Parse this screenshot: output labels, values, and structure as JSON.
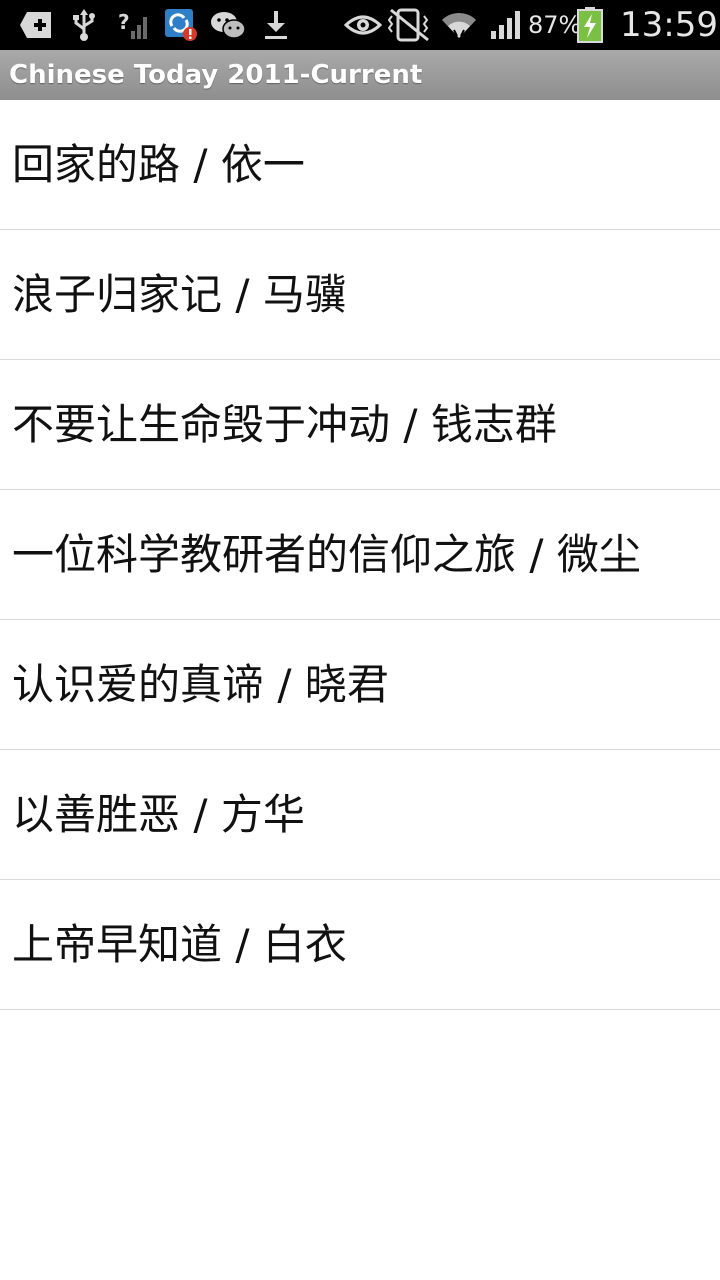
{
  "status_bar": {
    "battery_percent": "87%",
    "time": "13:59",
    "icons": [
      "add-notification-icon",
      "usb-icon",
      "no-sim-signal-icon",
      "sync-error-icon",
      "wechat-icon",
      "download-icon",
      "smart-stay-eye-icon",
      "vibrate-mute-icon",
      "wifi-icon",
      "cell-signal-icon",
      "battery-charging-icon"
    ],
    "battery_color": "#7ac143"
  },
  "app": {
    "title": "Chinese Today 2011-Current"
  },
  "articles": [
    {
      "label": "回家的路 / 依一"
    },
    {
      "label": "浪子归家记 / 马骥"
    },
    {
      "label": "不要让生命毁于冲动 / 钱志群"
    },
    {
      "label": "一位科学教研者的信仰之旅 / 微尘"
    },
    {
      "label": "认识爱的真谛 / 晓君"
    },
    {
      "label": "以善胜恶 / 方华"
    },
    {
      "label": "上帝早知道 / 白衣"
    }
  ]
}
